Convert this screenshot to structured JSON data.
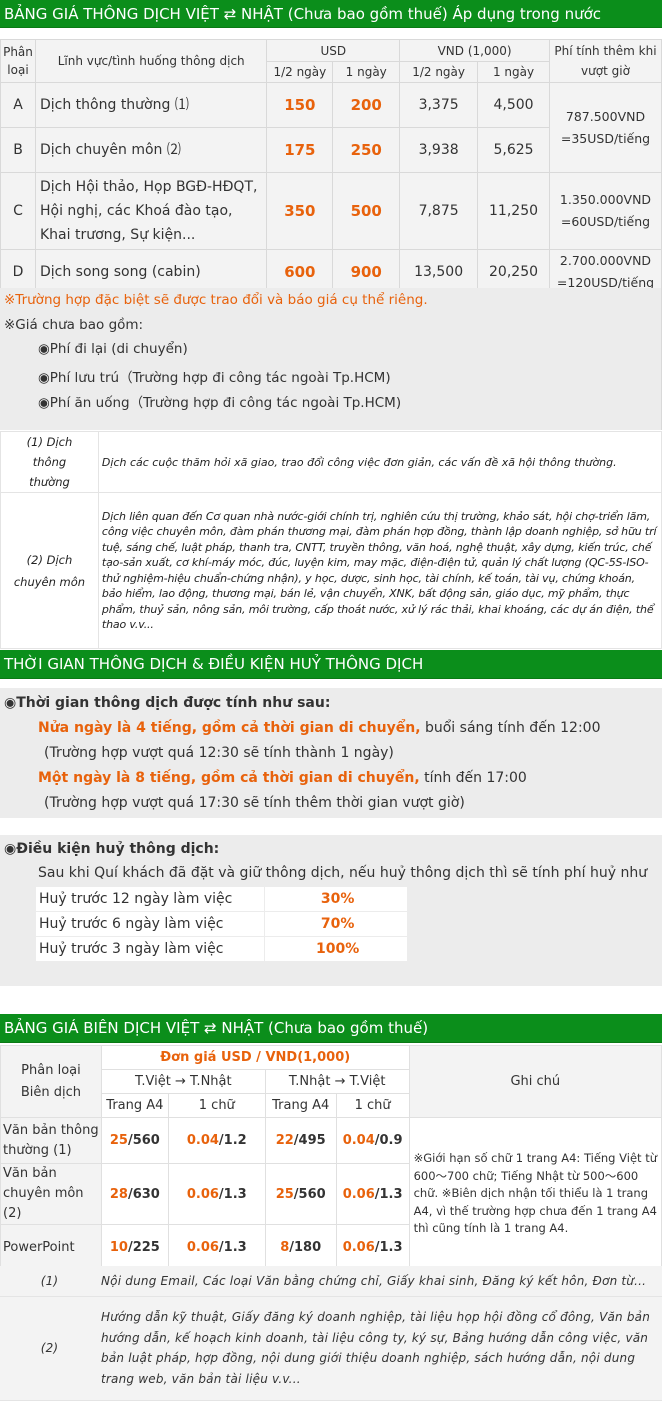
{
  "interpretation": {
    "title": "BẢNG GIÁ THÔNG DỊCH VIỆT ⇄ NHẬT (Chưa bao gồm thuế) Áp dụng trong nước",
    "headers": {
      "category": "Phân loại",
      "field": "Lĩnh vực/tình huống thông dịch",
      "usd": "USD",
      "vnd": "VND (1,000)",
      "extra": "Phí tính thêm khi vượt giờ",
      "half_day": "1/2 ngày",
      "full_day": "1 ngày"
    },
    "rows": [
      {
        "cat": "A",
        "field": "Dịch thông thường ⑴",
        "usd_half": "150",
        "usd_full": "200",
        "vnd_half": "3,375",
        "vnd_full": "4,500"
      },
      {
        "cat": "B",
        "field": "Dịch chuyên môn ⑵",
        "usd_half": "175",
        "usd_full": "250",
        "vnd_half": "3,938",
        "vnd_full": "5,625"
      },
      {
        "cat": "C",
        "field": "Dịch Hội thảo, Họp BGĐ-HĐQT, Hội nghị, các Khoá đào tạo, Khai trương, Sự kiện...",
        "usd_half": "350",
        "usd_full": "500",
        "vnd_half": "7,875",
        "vnd_full": "11,250",
        "extra": "1.350.000VND =60USD/tiếng"
      },
      {
        "cat": "D",
        "field": "Dịch song song (cabin)",
        "usd_half": "600",
        "usd_full": "900",
        "vnd_half": "13,500",
        "vnd_full": "20,250",
        "extra": "2.700.000VND =120USD/tiếng"
      }
    ],
    "extra_ab": "787.500VND =35USD/tiếng",
    "special_note": "※Trường hợp đặc biệt sẽ được trao đổi và báo giá cụ thể riêng.",
    "not_included_title": "※Giá chưa bao gồm:",
    "not_included": [
      "◉Phí đi lại (di chuyển)",
      "◉Phí lưu trú（Trường hợp đi công tác ngoài Tp.HCM)",
      "◉Phí ăn uống（Trường hợp đi công tác ngoài Tp.HCM)"
    ],
    "definitions": [
      {
        "key": "(1) Dịch thông thường",
        "text": "Dịch các cuộc thăm hỏi xã giao, trao đổi công việc đơn giản, các vấn đề xã hội thông thường."
      },
      {
        "key": "(2) Dịch chuyên môn",
        "text": "Dịch liên quan đến Cơ quan nhà nước-giới chính trị, nghiên cứu thị trường, khảo sát, hội chợ-triển lãm, công việc chuyên môn, đàm phán thương mại, đàm phán hợp đồng, thành lập doanh nghiệp, sở hữu trí tuệ, sáng chế, luật pháp, thanh tra, CNTT, truyền thông, văn hoá, nghệ thuật, xây dựng, kiến trúc, chế tạo-sản xuất, cơ khí-máy móc, đúc, luyện kim, may mặc, điện-điện tử, quản lý chất lượng (QC-5S-ISO-thử nghiệm-hiệu chuẩn-chứng nhận), y học, dược, sinh học, tài chính, kế toán, tài vụ, chứng khoán, bảo hiểm, lao động, thương mại, bán lẻ, vận chuyển, XNK, bất động sản, giáo dục, mỹ phẩm, thực phẩm, thuỷ sản, nông sản, môi trường, cấp thoát nước, xử lý rác thải, khai khoáng, các dự án điện, thể thao v.v..."
      }
    ]
  },
  "time_cancel": {
    "title": "THỜI GIAN THÔNG DỊCH & ĐIỀU KIỆN HUỶ THÔNG DỊCH",
    "time_heading": "◉Thời gian thông dịch được tính như sau:",
    "half_bold": "Nửa ngày là 4 tiếng, gồm cả thời gian di chuyển,",
    "half_rest": " buổi sáng tính đến 12:00",
    "half_sub": "(Trường hợp vượt quá 12:30 sẽ tính thành 1 ngày)",
    "full_bold": "Một ngày là 8 tiếng, gồm cả thời gian di chuyển,",
    "full_rest": " tính đến 17:00",
    "full_sub": "(Trường hợp vượt quá 17:30 sẽ tính thêm thời gian vượt giờ)",
    "cancel_heading": "◉Điều kiện huỷ thông dịch:",
    "cancel_intro": "Sau khi Quí khách đã đặt và giữ thông dịch, nếu huỷ thông dịch thì sẽ tính phí huỷ như",
    "cancel_rows": [
      {
        "label": "Huỷ trước 12 ngày làm việc",
        "pct": "30%"
      },
      {
        "label": "Huỷ trước 6 ngày làm việc",
        "pct": "70%"
      },
      {
        "label": "Huỷ trước 3 ngày làm việc",
        "pct": "100%"
      }
    ]
  },
  "translation": {
    "title": "BẢNG GIÁ BIÊN DỊCH VIỆT ⇄ NHẬT (Chưa bao gồm thuế)",
    "h_category": "Phân loại Biên dịch",
    "h_unit": "Đơn giá USD / VND(1,000)",
    "h_vj": "T.Việt → T.Nhật",
    "h_jv": "T.Nhật → T.Việt",
    "h_page": "Trang A4",
    "h_char": "1 chữ",
    "h_note": "Ghi chú",
    "rows": [
      {
        "cat": "Văn bản thông thường (1)",
        "vj_page_usd": "25",
        "vj_page_vnd": "/560",
        "vj_char_usd": "0.04",
        "vj_char_vnd": "/1.2",
        "jv_page_usd": "22",
        "jv_page_vnd": "/495",
        "jv_char_usd": "0.04",
        "jv_char_vnd": "/0.9"
      },
      {
        "cat": "Văn bản chuyên môn (2)",
        "vj_page_usd": "28",
        "vj_page_vnd": "/630",
        "vj_char_usd": "0.06",
        "vj_char_vnd": "/1.3",
        "jv_page_usd": "25",
        "jv_page_vnd": "/560",
        "jv_char_usd": "0.06",
        "jv_char_vnd": "/1.3"
      },
      {
        "cat": "PowerPoint",
        "vj_page_usd": "10",
        "vj_page_vnd": "/225",
        "vj_char_usd": "0.06",
        "vj_char_vnd": "/1.3",
        "jv_page_usd": "8",
        "jv_page_vnd": "/180",
        "jv_char_usd": "0.06",
        "jv_char_vnd": "/1.3"
      }
    ],
    "note": "※Giới hạn số chữ 1 trang A4: Tiếng Việt từ 600～700 chữ; Tiếng Nhật từ 500～600 chữ. ※Biên dịch nhận tối thiểu là 1 trang A4, vì thế trường hợp chưa đến 1 trang A4 thì cũng tính là 1 trang A4.",
    "definitions": [
      {
        "key": "(1)",
        "text": "Nội dung Email, Các loại Văn bằng chứng chỉ, Giấy khai sinh, Đăng ký kết hôn, Đơn từ..."
      },
      {
        "key": "(2)",
        "text": "Hướng dẫn kỹ thuật, Giấy đăng ký doanh nghiệp, tài liệu họp hội đồng cổ đông, Văn bản hướng dẫn, kế hoạch kinh doanh, tài liệu công ty, ký sự, Bảng hướng dẫn công việc, văn bản luật pháp, hợp đồng, nội dung giới thiệu doanh nghiệp, sách hướng dẫn, nội dung trang web, văn bản tài liệu v.v..."
      }
    ]
  },
  "colors": {
    "green": "#0b8e1b",
    "orange": "#e8620c",
    "grey": "#ececec"
  }
}
